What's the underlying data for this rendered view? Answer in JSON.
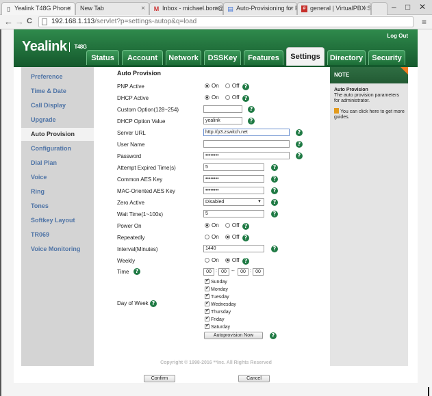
{
  "browser": {
    "tabs": [
      {
        "title": "Yealink T48G Phone",
        "icon": "page-icon",
        "active": true
      },
      {
        "title": "New Tab",
        "icon": "",
        "active": false
      },
      {
        "title": "Inbox - michael.bom@vi",
        "icon": "gmail-icon",
        "active": false
      },
      {
        "title": "Auto-Provisioning for Po",
        "icon": "doc-icon",
        "active": false
      },
      {
        "title": "general | VirtualPBX Sla",
        "icon": "slack-icon",
        "active": false
      }
    ],
    "window_controls": {
      "minimize": "–",
      "maximize": "□",
      "close": "✕"
    },
    "nav": {
      "back": "←",
      "forward": "→",
      "reload": "C"
    },
    "url_host": "192.168.1.113",
    "url_path": "/servlet?p=settings-autop&q=load",
    "menu": "≡"
  },
  "header": {
    "logo": "Yealink",
    "model": "T48G",
    "logout": "Log Out",
    "tabs": [
      "Status",
      "Account",
      "Network",
      "DSSKey",
      "Features",
      "Settings",
      "Directory",
      "Security"
    ],
    "active_tab": "Settings"
  },
  "sidebar": {
    "items": [
      "Preference",
      "Time & Date",
      "Call Display",
      "Upgrade",
      "Auto Provision",
      "Configuration",
      "Dial Plan",
      "Voice",
      "Ring",
      "Tones",
      "Softkey Layout",
      "TR069",
      "Voice Monitoring"
    ],
    "active": "Auto Provision"
  },
  "form": {
    "title": "Auto Provision",
    "on_label": "On",
    "off_label": "Off",
    "pnp_active": {
      "label": "PNP Active",
      "value": "On"
    },
    "dhcp_active": {
      "label": "DHCP Active",
      "value": "On"
    },
    "custom_option": {
      "label": "Custom Option(128~254)",
      "value": ""
    },
    "dhcp_option_value": {
      "label": "DHCP Option Value",
      "value": "yealink"
    },
    "server_url": {
      "label": "Server URL",
      "value": "http://p3.zswitch.net"
    },
    "user_name": {
      "label": "User Name",
      "value": ""
    },
    "password": {
      "label": "Password",
      "value": "••••••••"
    },
    "attempt_expired": {
      "label": "Attempt Expired Time(s)",
      "value": "5"
    },
    "common_aes": {
      "label": "Common AES Key",
      "value": "••••••••"
    },
    "mac_aes": {
      "label": "MAC-Oriented AES Key",
      "value": "••••••••"
    },
    "zero_active": {
      "label": "Zero Active",
      "value": "Disabled"
    },
    "wait_time": {
      "label": "Wait Time(1~100s)",
      "value": "5"
    },
    "power_on": {
      "label": "Power On",
      "value": "On"
    },
    "repeatedly": {
      "label": "Repeatedly",
      "value": "Off"
    },
    "interval": {
      "label": "Interval(Minutes)",
      "value": "1440"
    },
    "weekly": {
      "label": "Weekly",
      "value": "Off"
    },
    "time": {
      "label": "Time",
      "h1": "00",
      "m1": "00",
      "sep": "--",
      "h2": "00",
      "m2": "00"
    },
    "day_of_week": {
      "label": "Day of Week",
      "days": [
        "Sunday",
        "Monday",
        "Tuesday",
        "Wednesday",
        "Thursday",
        "Friday",
        "Saturday"
      ]
    },
    "autoprovision_now": "Autoprovision Now",
    "confirm": "Confirm",
    "cancel": "Cancel"
  },
  "note": {
    "title": "NOTE",
    "heading": "Auto Provision",
    "text": "The auto provision parameters for administrator.",
    "guide": "You can click here to get more guides."
  },
  "footer": {
    "copyright": "Copyright © 1998-2016 **Inc. All Rights Reserved"
  },
  "colors": {
    "header_green": "#1f6b38",
    "nav_link": "#4f74a6",
    "help_green": "#1f7a44",
    "note_accent": "#f07b21"
  }
}
